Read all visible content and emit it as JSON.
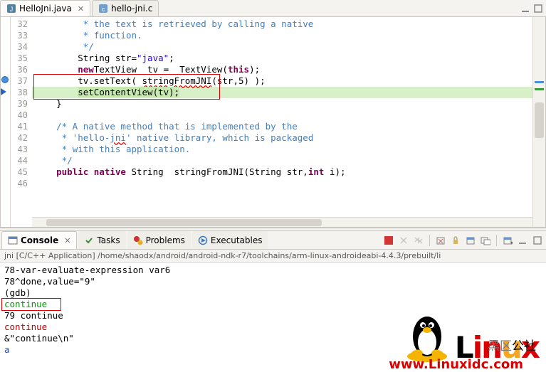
{
  "editor": {
    "tabs": [
      {
        "label": "HelloJni.java",
        "icon": "java"
      },
      {
        "label": "hello-jni.c",
        "icon": "c"
      }
    ],
    "line_start": 32,
    "lines": [
      {
        "n": 32,
        "ind": "         ",
        "comment": "* the text is retrieved by calling a native"
      },
      {
        "n": 33,
        "ind": "         ",
        "comment": "* function."
      },
      {
        "n": 34,
        "ind": "         ",
        "comment": "*/"
      },
      {
        "n": 35,
        "ind": "        ",
        "plain_pre": "String str=",
        "str": "\"java\"",
        "plain_post": ";"
      },
      {
        "n": 36,
        "ind": "        ",
        "plain_pre": "TextView  tv = ",
        "kw": "new",
        "plain_mid": " TextView(",
        "kw2": "this",
        "plain_post": ");"
      },
      {
        "n": 37,
        "ind": "        ",
        "plain_pre": "tv.setText( ",
        "sq": "stringFromJNI",
        "plain_post": "(str,5) );"
      },
      {
        "n": 38,
        "ind": "        ",
        "exec": "setContentView(tv);"
      },
      {
        "n": 39,
        "ind": "    ",
        "plain": "}"
      },
      {
        "n": 40,
        "ind": "",
        "plain": ""
      },
      {
        "n": 41,
        "ind": "    ",
        "comment": "/* A native method that is implemented by the"
      },
      {
        "n": 42,
        "ind": "     ",
        "comment": "* 'hello-jni' native library, which is packaged",
        "sq_comment": "jni"
      },
      {
        "n": 43,
        "ind": "     ",
        "comment": "* with this application."
      },
      {
        "n": 44,
        "ind": "     ",
        "comment": "*/"
      },
      {
        "n": 45,
        "ind": "    ",
        "kw": "public native",
        "plain_mid": " String  stringFromJNI(String str,",
        "kw2": "int",
        "plain_post": " i);"
      },
      {
        "n": 46,
        "ind": "",
        "plain": ""
      }
    ],
    "breakpoint_line": 37,
    "exec_line": 38
  },
  "bottom": {
    "tabs": [
      "Console",
      "Tasks",
      "Problems",
      "Executables"
    ],
    "active_tab": 0,
    "toolbar_icons": [
      "stop",
      "remove",
      "remove-all",
      "sep",
      "pin",
      "display-selected",
      "scroll-lock",
      "show-console",
      "sep",
      "open-console",
      "min",
      "max"
    ],
    "stop_color": "#d02020"
  },
  "console": {
    "header": "jni [C/C++ Application] /home/shaodx/android/android-ndk-r7/toolchains/arm-linux-androideabi-4.4.3/prebuilt/li",
    "lines": [
      {
        "t": "78-var-evaluate-expression var6",
        "c": ""
      },
      {
        "t": "78^done,value=\"9\"",
        "c": ""
      },
      {
        "t": "(gdb) ",
        "c": ""
      },
      {
        "t": "continue",
        "c": "green",
        "box": true
      },
      {
        "t": "79 continue",
        "c": ""
      },
      {
        "t": "continue",
        "c": "red"
      },
      {
        "t": "&\"continue\\n\"",
        "c": ""
      },
      {
        "t": "a",
        "c": "blue"
      }
    ]
  },
  "watermark": {
    "brand": "Linux",
    "cn1": "黑区",
    "cn2": "公社",
    "url": "www.Linuxidc.com"
  }
}
